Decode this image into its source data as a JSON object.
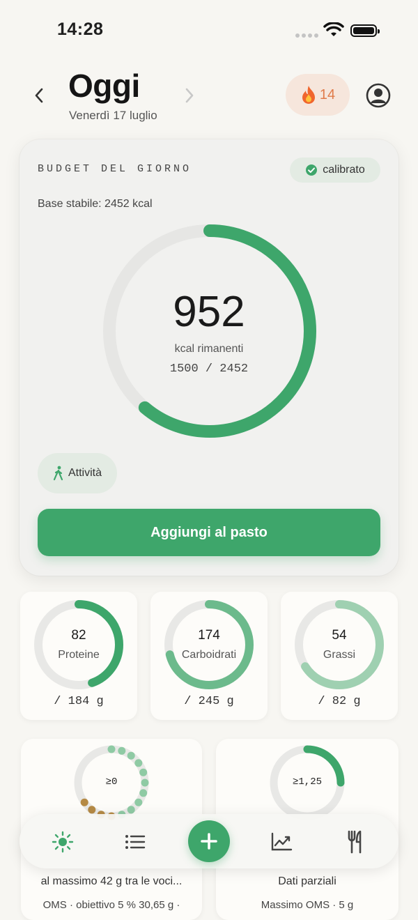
{
  "status_bar": {
    "time": "14:28"
  },
  "header": {
    "title": "Oggi",
    "date": "Venerdì 17 luglio",
    "streak_count": "14"
  },
  "budget": {
    "label": "BUDGET DEL GIORNO",
    "calibrated_label": "calibrato",
    "base": "Base stabile: 2452 kcal",
    "remaining": "952",
    "remaining_label": "kcal rimanenti",
    "ratio": "1500 / 2452",
    "consumed_fraction": 0.6117,
    "activity_label": "Attività",
    "add_button": "Aggiungi al pasto"
  },
  "macros": [
    {
      "value": "82",
      "name": "Proteine",
      "goal": "/ 184 g",
      "fraction": 0.446,
      "color": "#3ea66b"
    },
    {
      "value": "174",
      "name": "Carboidrati",
      "goal": "/ 245 g",
      "fraction": 0.71,
      "color": "#6cba8c"
    },
    {
      "value": "54",
      "name": "Grassi",
      "goal": "/ 82 g",
      "fraction": 0.659,
      "color": "#9fd0b1"
    }
  ],
  "cards": [
    {
      "ring_value": "≥0",
      "line1": "al massimo 42 g tra le voci...",
      "line2": "OMS · obiettivo 5 % 30,65 g ·"
    },
    {
      "ring_value": "≥1,25",
      "line1": "Dati parziali",
      "line2": "Massimo OMS · 5 g"
    }
  ],
  "colors": {
    "accent": "#3ea66b",
    "streak": "#e07b4a"
  },
  "tabbar": {
    "items": [
      "today-icon",
      "list-icon",
      "add-icon",
      "chart-icon",
      "utensils-icon"
    ]
  }
}
